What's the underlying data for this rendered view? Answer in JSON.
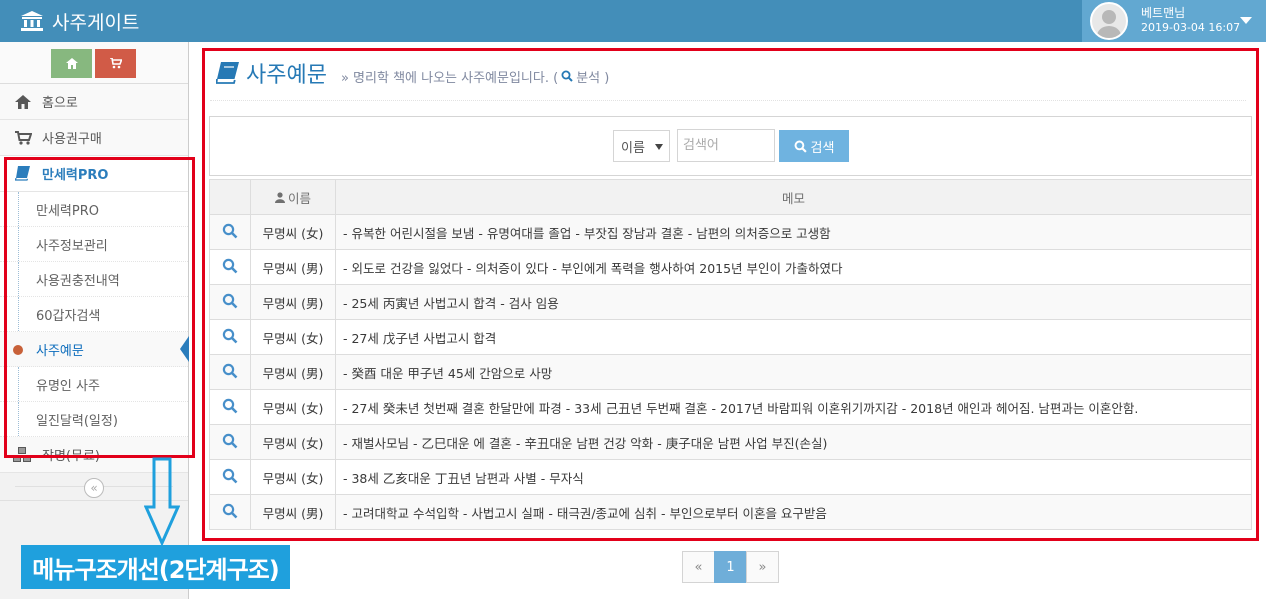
{
  "app": {
    "title": "사주게이트"
  },
  "user": {
    "name": "베트맨님",
    "datetime": "2019-03-04 16:07"
  },
  "sidebar": {
    "items": [
      {
        "label": "홈으로",
        "icon": "home-icon"
      },
      {
        "label": "사용권구매",
        "icon": "cart-icon"
      },
      {
        "label": "만세력PRO",
        "icon": "book-icon",
        "active": true
      },
      {
        "label": "작명(무료)",
        "icon": "cubes-icon"
      }
    ],
    "subitems": [
      {
        "label": "만세력PRO"
      },
      {
        "label": "사주정보관리"
      },
      {
        "label": "사용권충전내역"
      },
      {
        "label": "60갑자검색"
      },
      {
        "label": "사주예문",
        "current": true
      },
      {
        "label": "유명인 사주"
      },
      {
        "label": "일진달력(일정)"
      }
    ]
  },
  "annotation": {
    "callout": "메뉴구조개선(2단계구조)"
  },
  "page": {
    "title": "사주예문",
    "subtitle": "» 명리학 책에 나오는 사주예문입니다. (",
    "analysis_label": "분석 )"
  },
  "search": {
    "select_value": "이름",
    "placeholder": "검색어",
    "button_label": "검색"
  },
  "table": {
    "headers": [
      "이름",
      "메모"
    ],
    "rows": [
      {
        "name": "무명씨 (女)",
        "memo": "- 유복한 어린시절을 보냄 - 유명여대를 졸업 - 부잣집 장남과 결혼 - 남편의 의처증으로 고생함"
      },
      {
        "name": "무명씨 (男)",
        "memo": "- 외도로 건강을 잃었다 - 의처증이 있다 - 부인에게 폭력을 행사하여 2015년 부인이 가출하였다"
      },
      {
        "name": "무명씨 (男)",
        "memo": "- 25세 丙寅년 사법고시 합격 - 검사 임용"
      },
      {
        "name": "무명씨 (女)",
        "memo": "- 27세 戊子년 사법고시 합격"
      },
      {
        "name": "무명씨 (男)",
        "memo": "- 癸酉 대운 甲子년 45세 간암으로 사망"
      },
      {
        "name": "무명씨 (女)",
        "memo": "- 27세 癸未년 첫번째 결혼 한달만에 파경 - 33세 己丑년 두번째 결혼 - 2017년 바람피워 이혼위기까지감 - 2018년 애인과 헤어짐. 남편과는 이혼안함."
      },
      {
        "name": "무명씨 (女)",
        "memo": "- 재벌사모님 - 乙巳대운 에 결혼 - 辛丑대운 남편 건강 악화 - 庚子대운 남편 사업 부진(손실)"
      },
      {
        "name": "무명씨 (女)",
        "memo": "- 38세 乙亥대운 丁丑년 남편과 사별 - 무자식"
      },
      {
        "name": "무명씨 (男)",
        "memo": "- 고려대학교 수석입학 - 사법고시 실패 - 태극권/종교에 심취 - 부인으로부터 이혼을 요구받음"
      }
    ]
  },
  "pagination": {
    "prev": "«",
    "current": "1",
    "next": "»"
  },
  "colors": {
    "navbar": "#438eb9",
    "accent": "#2679b5",
    "highlight_border": "#e2001a",
    "callout": "#1fa0dd"
  }
}
